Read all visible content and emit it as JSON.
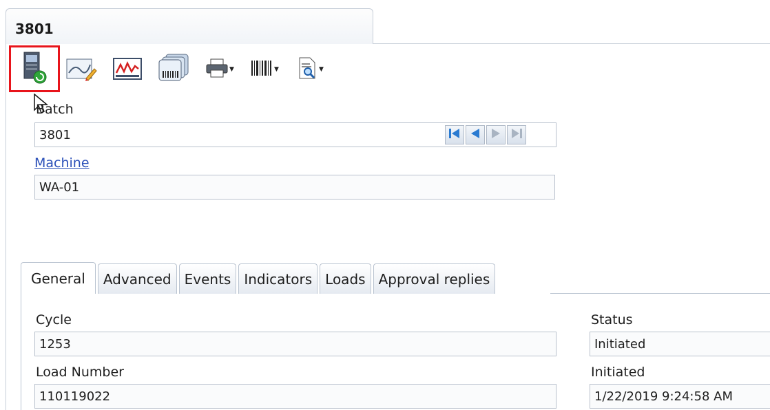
{
  "document": {
    "title": "3801"
  },
  "toolbar": {
    "icons": [
      "batch-info-icon",
      "edit-chart-icon",
      "trend-chart-icon",
      "barcode-cards-icon",
      "print-icon",
      "barcode-icon",
      "report-preview-icon"
    ]
  },
  "batch": {
    "label": "Batch",
    "value": "3801",
    "nav": [
      "first",
      "previous",
      "next",
      "last"
    ]
  },
  "machine": {
    "label": "Machine",
    "value": "WA-01"
  },
  "tabs": [
    {
      "label": "General",
      "active": true
    },
    {
      "label": "Advanced",
      "active": false
    },
    {
      "label": "Events",
      "active": false
    },
    {
      "label": "Indicators",
      "active": false
    },
    {
      "label": "Loads",
      "active": false
    },
    {
      "label": "Approval replies",
      "active": false
    }
  ],
  "general": {
    "cycle": {
      "label": "Cycle",
      "value": "1253"
    },
    "load_number": {
      "label": "Load Number",
      "value": "110119022"
    },
    "status": {
      "label": "Status",
      "value": "Initiated"
    },
    "initiated": {
      "label": "Initiated",
      "value": "1/22/2019 9:24:58 AM"
    }
  },
  "colors": {
    "highlight": "#e8141b",
    "link": "#2a4fb8",
    "nav_arrow": "#2b7bd1"
  }
}
